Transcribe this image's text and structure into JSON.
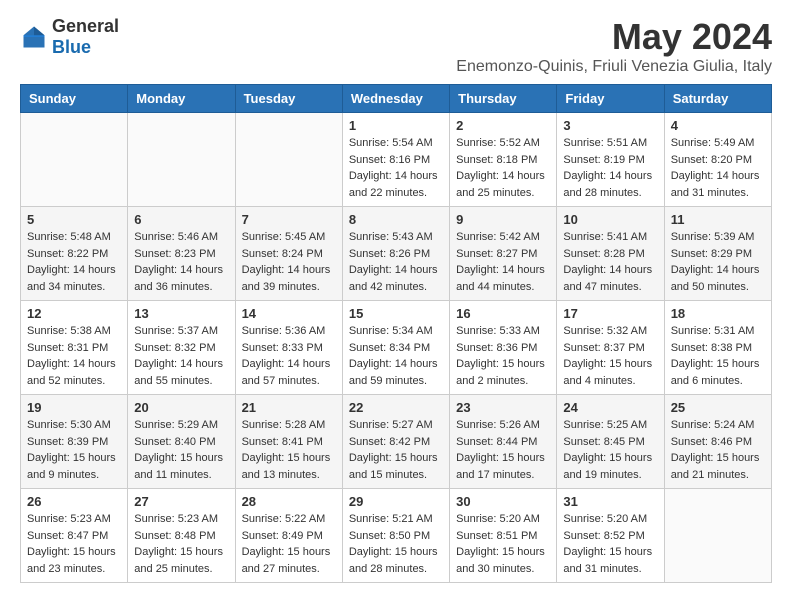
{
  "header": {
    "logo_general": "General",
    "logo_blue": "Blue",
    "month": "May 2024",
    "location": "Enemonzo-Quinis, Friuli Venezia Giulia, Italy"
  },
  "weekdays": [
    "Sunday",
    "Monday",
    "Tuesday",
    "Wednesday",
    "Thursday",
    "Friday",
    "Saturday"
  ],
  "weeks": [
    [
      {
        "day": "",
        "sunrise": "",
        "sunset": "",
        "daylight": ""
      },
      {
        "day": "",
        "sunrise": "",
        "sunset": "",
        "daylight": ""
      },
      {
        "day": "",
        "sunrise": "",
        "sunset": "",
        "daylight": ""
      },
      {
        "day": "1",
        "sunrise": "Sunrise: 5:54 AM",
        "sunset": "Sunset: 8:16 PM",
        "daylight": "Daylight: 14 hours and 22 minutes."
      },
      {
        "day": "2",
        "sunrise": "Sunrise: 5:52 AM",
        "sunset": "Sunset: 8:18 PM",
        "daylight": "Daylight: 14 hours and 25 minutes."
      },
      {
        "day": "3",
        "sunrise": "Sunrise: 5:51 AM",
        "sunset": "Sunset: 8:19 PM",
        "daylight": "Daylight: 14 hours and 28 minutes."
      },
      {
        "day": "4",
        "sunrise": "Sunrise: 5:49 AM",
        "sunset": "Sunset: 8:20 PM",
        "daylight": "Daylight: 14 hours and 31 minutes."
      }
    ],
    [
      {
        "day": "5",
        "sunrise": "Sunrise: 5:48 AM",
        "sunset": "Sunset: 8:22 PM",
        "daylight": "Daylight: 14 hours and 34 minutes."
      },
      {
        "day": "6",
        "sunrise": "Sunrise: 5:46 AM",
        "sunset": "Sunset: 8:23 PM",
        "daylight": "Daylight: 14 hours and 36 minutes."
      },
      {
        "day": "7",
        "sunrise": "Sunrise: 5:45 AM",
        "sunset": "Sunset: 8:24 PM",
        "daylight": "Daylight: 14 hours and 39 minutes."
      },
      {
        "day": "8",
        "sunrise": "Sunrise: 5:43 AM",
        "sunset": "Sunset: 8:26 PM",
        "daylight": "Daylight: 14 hours and 42 minutes."
      },
      {
        "day": "9",
        "sunrise": "Sunrise: 5:42 AM",
        "sunset": "Sunset: 8:27 PM",
        "daylight": "Daylight: 14 hours and 44 minutes."
      },
      {
        "day": "10",
        "sunrise": "Sunrise: 5:41 AM",
        "sunset": "Sunset: 8:28 PM",
        "daylight": "Daylight: 14 hours and 47 minutes."
      },
      {
        "day": "11",
        "sunrise": "Sunrise: 5:39 AM",
        "sunset": "Sunset: 8:29 PM",
        "daylight": "Daylight: 14 hours and 50 minutes."
      }
    ],
    [
      {
        "day": "12",
        "sunrise": "Sunrise: 5:38 AM",
        "sunset": "Sunset: 8:31 PM",
        "daylight": "Daylight: 14 hours and 52 minutes."
      },
      {
        "day": "13",
        "sunrise": "Sunrise: 5:37 AM",
        "sunset": "Sunset: 8:32 PM",
        "daylight": "Daylight: 14 hours and 55 minutes."
      },
      {
        "day": "14",
        "sunrise": "Sunrise: 5:36 AM",
        "sunset": "Sunset: 8:33 PM",
        "daylight": "Daylight: 14 hours and 57 minutes."
      },
      {
        "day": "15",
        "sunrise": "Sunrise: 5:34 AM",
        "sunset": "Sunset: 8:34 PM",
        "daylight": "Daylight: 14 hours and 59 minutes."
      },
      {
        "day": "16",
        "sunrise": "Sunrise: 5:33 AM",
        "sunset": "Sunset: 8:36 PM",
        "daylight": "Daylight: 15 hours and 2 minutes."
      },
      {
        "day": "17",
        "sunrise": "Sunrise: 5:32 AM",
        "sunset": "Sunset: 8:37 PM",
        "daylight": "Daylight: 15 hours and 4 minutes."
      },
      {
        "day": "18",
        "sunrise": "Sunrise: 5:31 AM",
        "sunset": "Sunset: 8:38 PM",
        "daylight": "Daylight: 15 hours and 6 minutes."
      }
    ],
    [
      {
        "day": "19",
        "sunrise": "Sunrise: 5:30 AM",
        "sunset": "Sunset: 8:39 PM",
        "daylight": "Daylight: 15 hours and 9 minutes."
      },
      {
        "day": "20",
        "sunrise": "Sunrise: 5:29 AM",
        "sunset": "Sunset: 8:40 PM",
        "daylight": "Daylight: 15 hours and 11 minutes."
      },
      {
        "day": "21",
        "sunrise": "Sunrise: 5:28 AM",
        "sunset": "Sunset: 8:41 PM",
        "daylight": "Daylight: 15 hours and 13 minutes."
      },
      {
        "day": "22",
        "sunrise": "Sunrise: 5:27 AM",
        "sunset": "Sunset: 8:42 PM",
        "daylight": "Daylight: 15 hours and 15 minutes."
      },
      {
        "day": "23",
        "sunrise": "Sunrise: 5:26 AM",
        "sunset": "Sunset: 8:44 PM",
        "daylight": "Daylight: 15 hours and 17 minutes."
      },
      {
        "day": "24",
        "sunrise": "Sunrise: 5:25 AM",
        "sunset": "Sunset: 8:45 PM",
        "daylight": "Daylight: 15 hours and 19 minutes."
      },
      {
        "day": "25",
        "sunrise": "Sunrise: 5:24 AM",
        "sunset": "Sunset: 8:46 PM",
        "daylight": "Daylight: 15 hours and 21 minutes."
      }
    ],
    [
      {
        "day": "26",
        "sunrise": "Sunrise: 5:23 AM",
        "sunset": "Sunset: 8:47 PM",
        "daylight": "Daylight: 15 hours and 23 minutes."
      },
      {
        "day": "27",
        "sunrise": "Sunrise: 5:23 AM",
        "sunset": "Sunset: 8:48 PM",
        "daylight": "Daylight: 15 hours and 25 minutes."
      },
      {
        "day": "28",
        "sunrise": "Sunrise: 5:22 AM",
        "sunset": "Sunset: 8:49 PM",
        "daylight": "Daylight: 15 hours and 27 minutes."
      },
      {
        "day": "29",
        "sunrise": "Sunrise: 5:21 AM",
        "sunset": "Sunset: 8:50 PM",
        "daylight": "Daylight: 15 hours and 28 minutes."
      },
      {
        "day": "30",
        "sunrise": "Sunrise: 5:20 AM",
        "sunset": "Sunset: 8:51 PM",
        "daylight": "Daylight: 15 hours and 30 minutes."
      },
      {
        "day": "31",
        "sunrise": "Sunrise: 5:20 AM",
        "sunset": "Sunset: 8:52 PM",
        "daylight": "Daylight: 15 hours and 31 minutes."
      },
      {
        "day": "",
        "sunrise": "",
        "sunset": "",
        "daylight": ""
      }
    ]
  ]
}
